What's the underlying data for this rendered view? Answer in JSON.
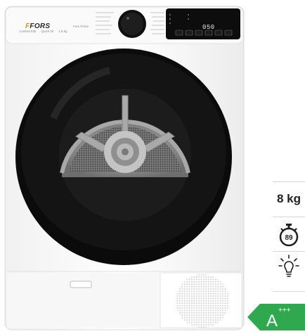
{
  "product": {
    "brand": "FORS",
    "model_label": "Fors Prime",
    "panel_labels": [
      "Limited Edit",
      "Quick 30",
      "1.8 kg"
    ],
    "display_value": "050"
  },
  "specs": {
    "capacity": "8 kg",
    "program_time_badge": "89",
    "icons": [
      "stopwatch-icon",
      "light-bulb-icon"
    ]
  },
  "energy": {
    "class_letter": "A",
    "class_plus": "+++",
    "arrow_color": "#2fa84f"
  },
  "colors": {
    "body": "#ffffff",
    "door_ring": "#0c0c0c",
    "drum": "#8e8e8e",
    "display": "#0d0d0d"
  }
}
